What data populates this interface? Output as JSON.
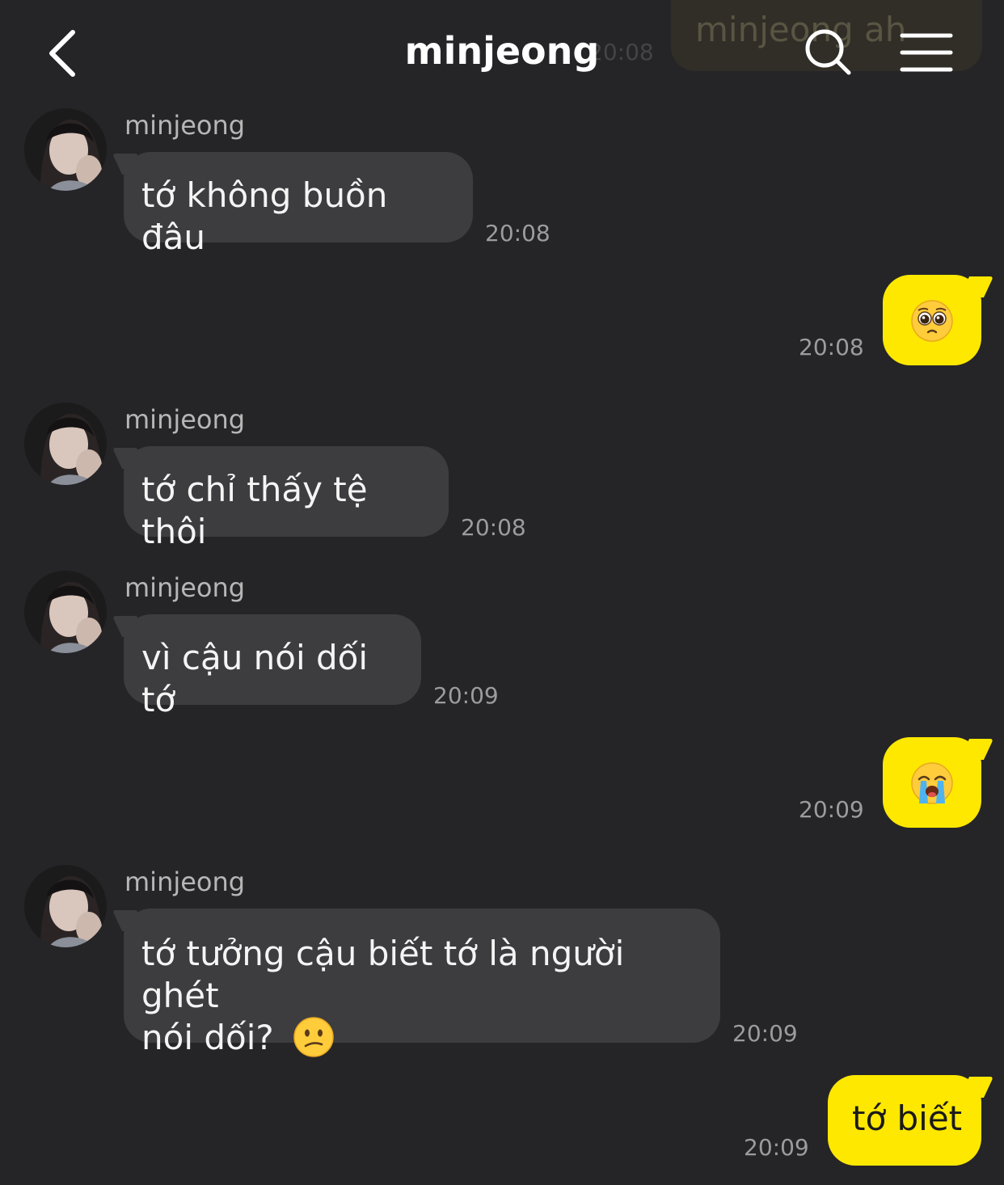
{
  "header": {
    "title": "minjeong",
    "back_icon": "chevron-left-icon",
    "search_icon": "search-icon",
    "menu_icon": "hamburger-menu-icon"
  },
  "ghost": {
    "text": "minjeong ah",
    "time": "20:08"
  },
  "messages": [
    {
      "sender": "minjeong",
      "text": "tớ không buồn đâu",
      "time": "20:08"
    },
    {
      "emoji": "pleading-face-emoji",
      "time": "20:08"
    },
    {
      "sender": "minjeong",
      "text": "tớ chỉ thấy tệ thôi",
      "time": "20:08"
    },
    {
      "sender": "minjeong",
      "text": "vì cậu nói dối tớ",
      "time": "20:09"
    },
    {
      "emoji": "loudly-crying-face-emoji",
      "time": "20:09"
    },
    {
      "sender": "minjeong",
      "text_line1": "tớ tưởng cậu biết tớ là người ghét",
      "text_line2": "nói dối?",
      "emoji": "confused-face-emoji",
      "time": "20:09"
    },
    {
      "text": "tớ biết",
      "time": "20:09"
    }
  ],
  "colors": {
    "background": "#252528",
    "incoming_bubble": "#3d3d3f",
    "outgoing_bubble": "#fee800"
  }
}
